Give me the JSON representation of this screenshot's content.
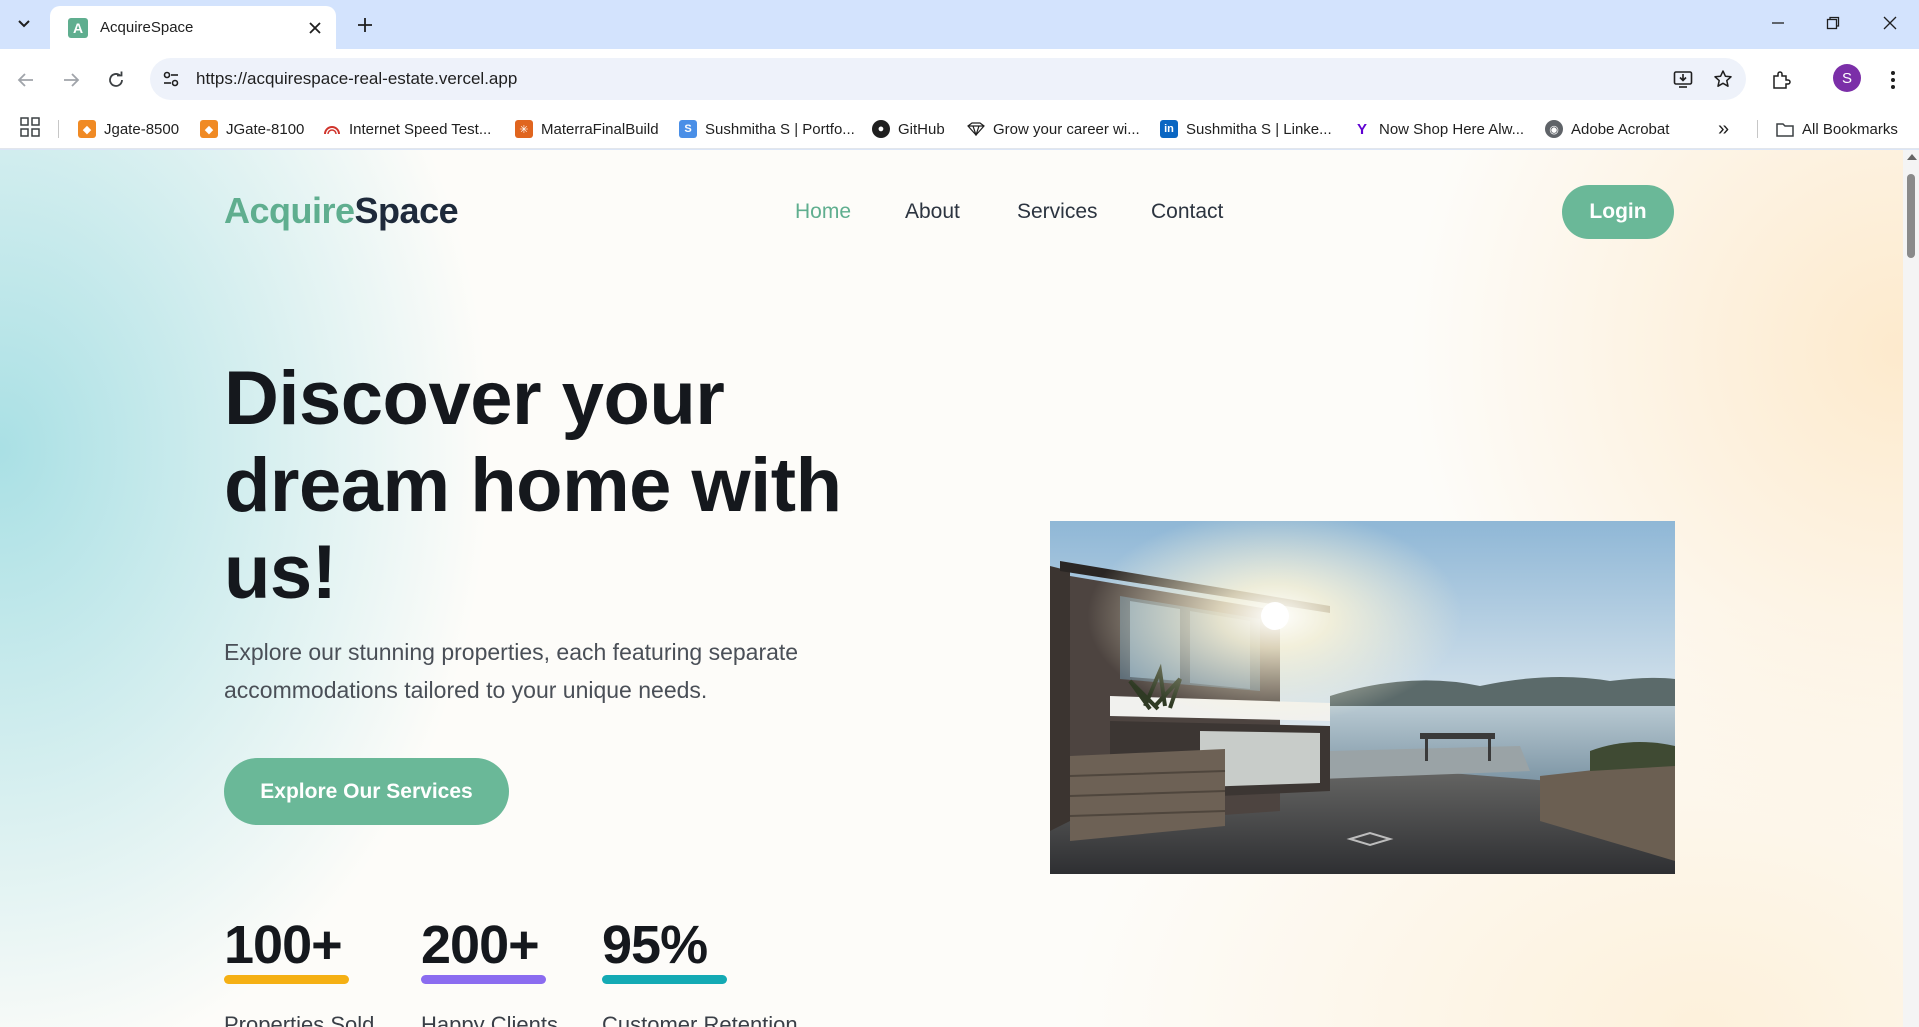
{
  "browser": {
    "tab_title": "AcquireSpace",
    "favicon_letter": "A",
    "url": "https://acquirespace-real-estate.vercel.app",
    "profile_initial": "S",
    "bookmarks": [
      {
        "label": "Jgate-8500",
        "icon": "jgate-icon",
        "color": "#f08a24"
      },
      {
        "label": "JGate-8100",
        "icon": "jgate-icon",
        "color": "#f08a24"
      },
      {
        "label": "Internet Speed Test...",
        "icon": "speed-gauge-icon",
        "color": "#d0342c"
      },
      {
        "label": "MaterraFinalBuild",
        "icon": "materra-icon",
        "color": "#e0651f"
      },
      {
        "label": "Sushmitha S | Portfo...",
        "icon": "portfolio-icon",
        "color": "#4a8fe7"
      },
      {
        "label": "GitHub",
        "icon": "github-icon",
        "color": "#1f1f1f"
      },
      {
        "label": "Grow your career wi...",
        "icon": "diamond-icon",
        "color": "#1f1f1f"
      },
      {
        "label": "Sushmitha S | Linke...",
        "icon": "linkedin-icon",
        "color": "#0a66c2"
      },
      {
        "label": "Now Shop Here Alw...",
        "icon": "yahoo-icon",
        "color": "#5f01d1"
      },
      {
        "label": "Adobe Acrobat",
        "icon": "globe-icon",
        "color": "#5f6368"
      }
    ],
    "bookmarks_overflow": "»",
    "all_bookmarks": "All Bookmarks"
  },
  "site": {
    "logo_part1": "Acquire",
    "logo_part2": "Space",
    "nav": [
      {
        "label": "Home",
        "active": true
      },
      {
        "label": "About",
        "active": false
      },
      {
        "label": "Services",
        "active": false
      },
      {
        "label": "Contact",
        "active": false
      }
    ],
    "login_label": "Login",
    "hero_title": "Discover your dream home with us!",
    "hero_subtitle": "Explore our stunning properties, each featuring separate accommodations tailored to your unique needs.",
    "cta_label": "Explore Our Services",
    "stats": [
      {
        "value": "100+",
        "label": "Properties Sold",
        "color": "#f5b014"
      },
      {
        "value": "200+",
        "label": "Happy Clients",
        "color": "#8b6cf0"
      },
      {
        "value": "95%",
        "label": "Customer Retention",
        "color": "#14aab4"
      }
    ],
    "accent_color": "#6ab898"
  }
}
